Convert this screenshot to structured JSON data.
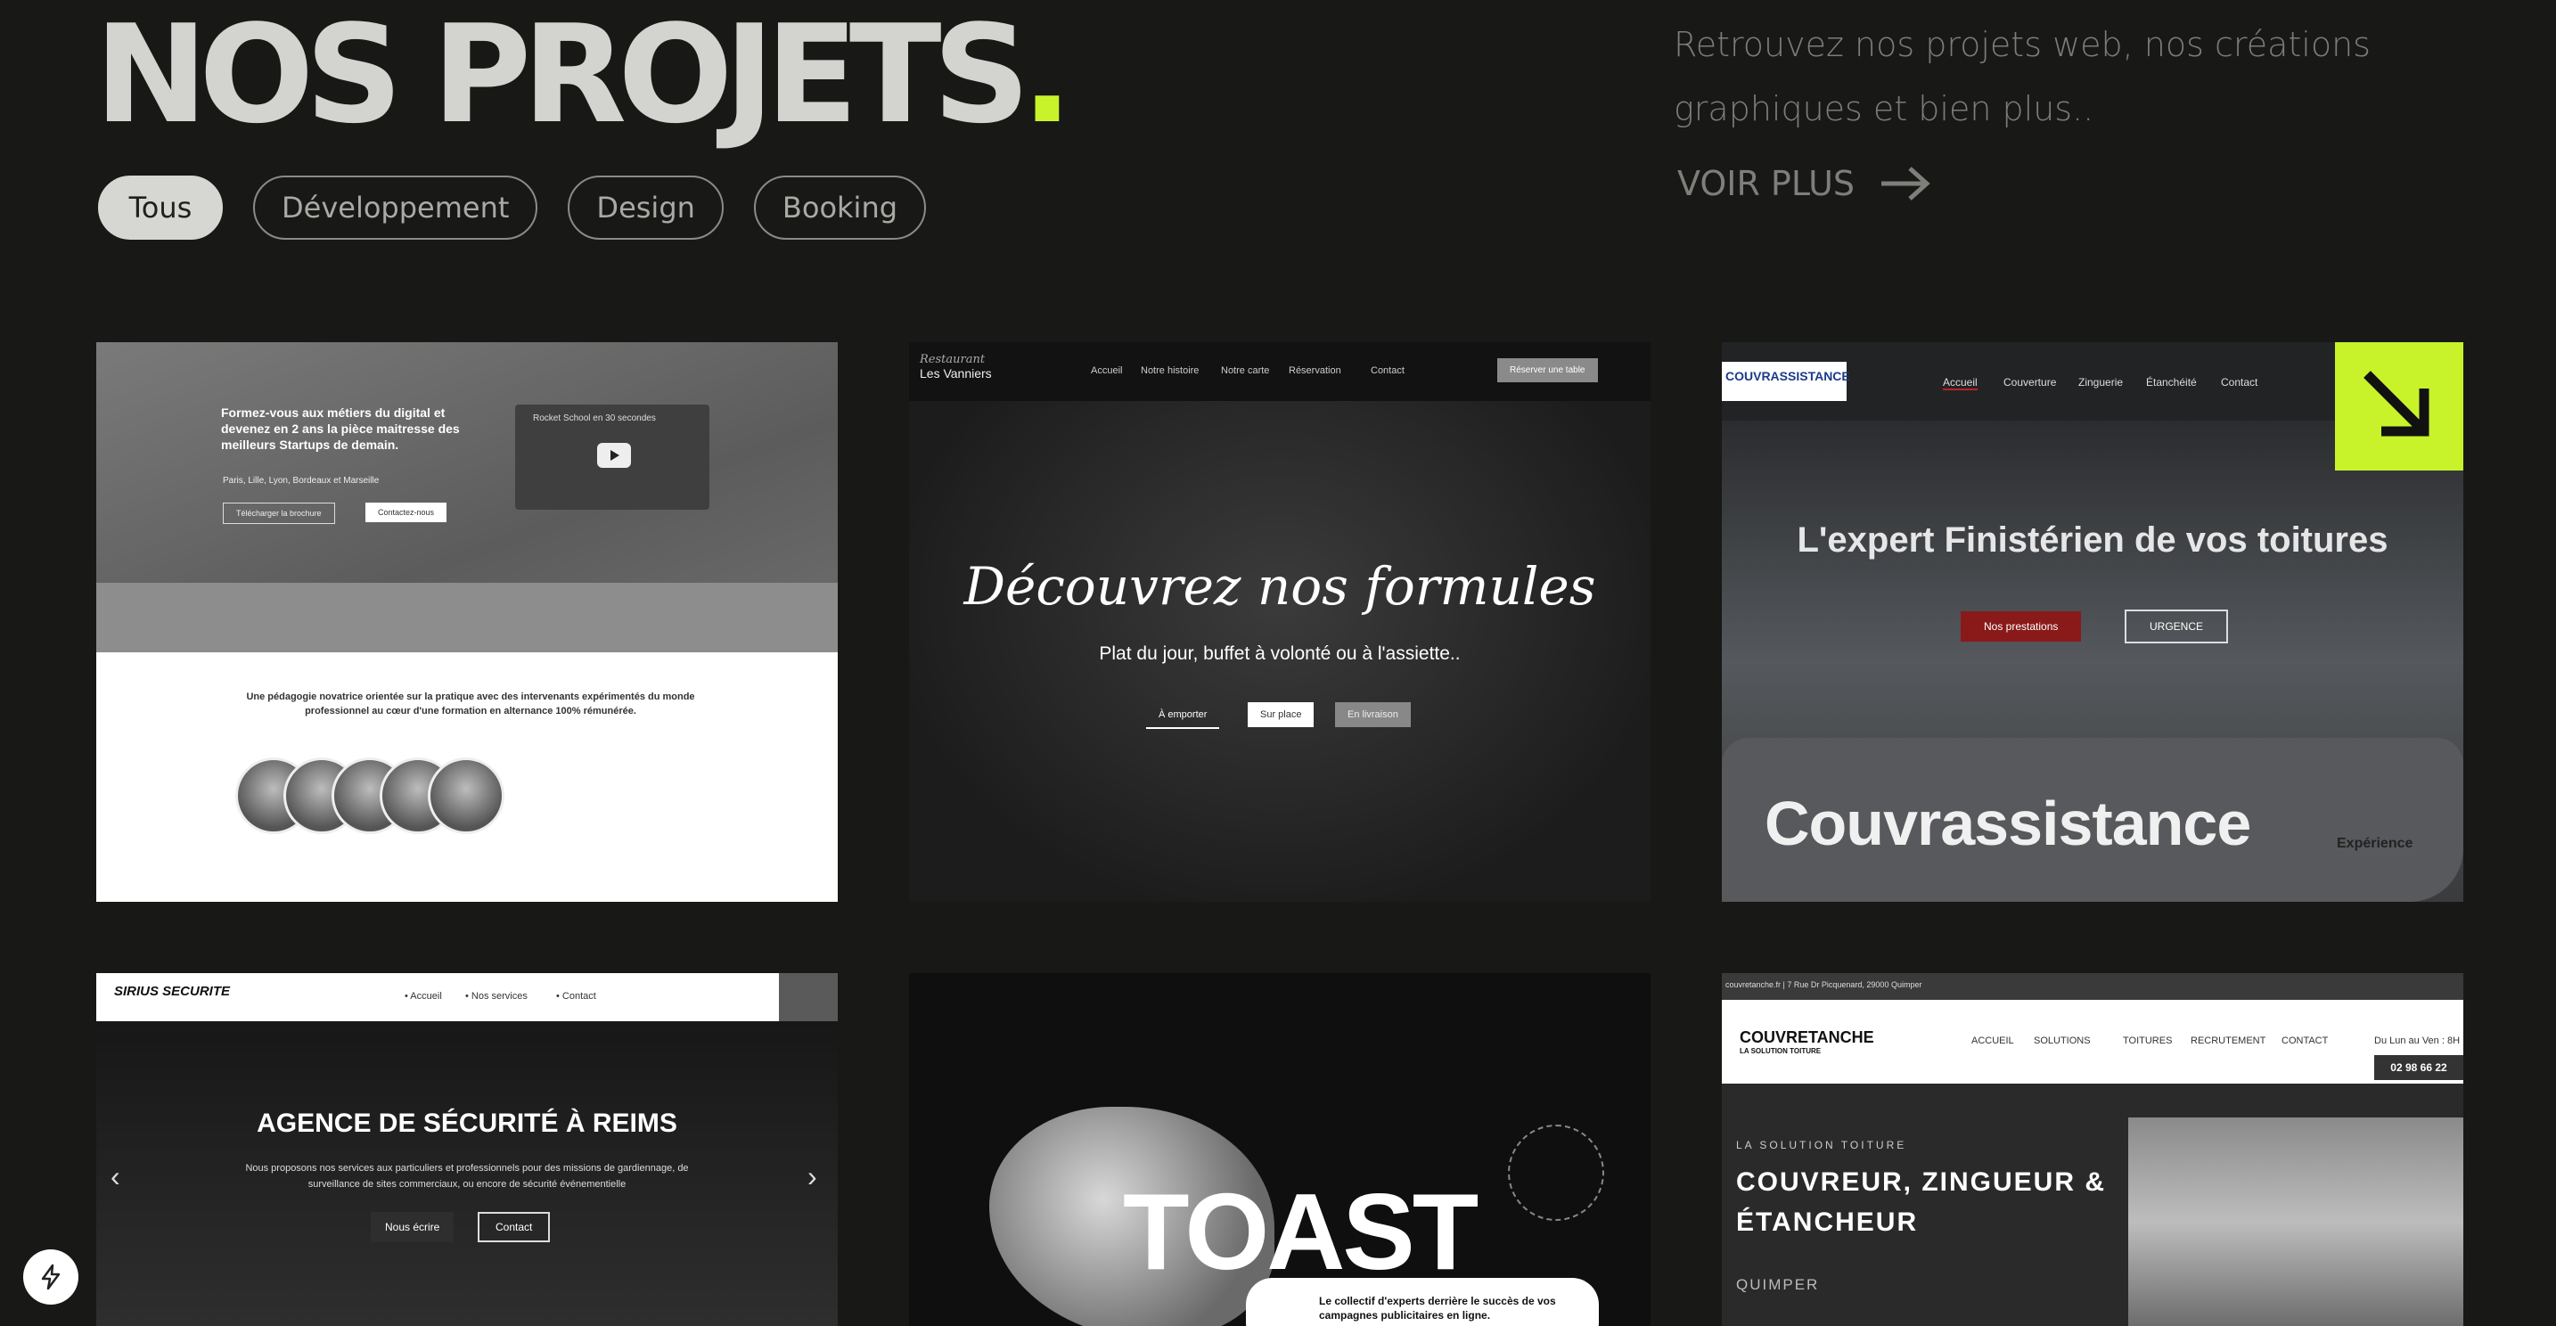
{
  "header": {
    "title": "NOS PROJETS",
    "title_dot": ".",
    "intro": "Retrouvez nos projets web, nos créations graphiques et bien plus..",
    "voir_plus": "VOIR PLUS"
  },
  "filters": [
    "Tous",
    "Développement",
    "Design",
    "Booking"
  ],
  "colors": {
    "accent": "#c8f32a",
    "background": "#181817"
  },
  "projects": [
    {
      "headline": "Formez-vous aux métiers du digital et devenez en 2 ans la pièce maitresse des meilleurs Startups de demain.",
      "locations": "Paris, Lille, Lyon, Bordeaux et Marseille",
      "btn1": "Télécharger la brochure",
      "btn2": "Contactez-nous",
      "video_title": "Rocket School en 30 secondes",
      "pedagogy": "Une pédagogie novatrice orientée sur la pratique avec des intervenants expérimentés du monde professionnel au cœur d'une formation en alternance 100% rémunérée."
    },
    {
      "logo_script": "Restaurant",
      "logo": "Les Vanniers",
      "nav": [
        "Accueil",
        "Notre histoire",
        "Notre carte",
        "Réservation",
        "Contact"
      ],
      "reserve": "Réserver une table",
      "headline": "Découvrez nos formules",
      "sub": "Plat du jour, buffet à volonté ou à l'assiette..",
      "btn1": "À emporter",
      "btn2": "Sur place",
      "btn3": "En livraison"
    },
    {
      "logo": "COUVRASSISTANCE",
      "nav": [
        "Accueil",
        "Couverture",
        "Zinguerie",
        "Étanchéité",
        "Contact"
      ],
      "headline": "L'expert Finistérien de vos toitures",
      "btn1": "Nos prestations",
      "btn2": "URGENCE",
      "name": "Couvrassistance",
      "badge": "Expérience"
    },
    {
      "logo": "SIRIUS SECURITE",
      "nav": [
        "• Accueil",
        "• Nos services",
        "• Contact"
      ],
      "headline": "AGENCE DE SÉCURITÉ À REIMS",
      "text": "Nous proposons nos services aux particuliers et professionnels pour des missions de gardiennage, de surveillance de sites commerciaux, ou encore de sécurité événementielle",
      "btn1": "Nous écrire",
      "btn2": "Contact"
    },
    {
      "name": "TOAST",
      "tagline": "Le collectif d'experts derrière le succès de vos campagnes publicitaires en ligne."
    },
    {
      "topbar": "couvretanche.fr | 7 Rue Dr Picquenard, 29000 Quimper",
      "logo": "COUVRETANCHE",
      "logo_sub": "LA SOLUTION TOITURE",
      "nav": [
        "ACCUEIL",
        "SOLUTIONS",
        "TOITURES",
        "RECRUTEMENT",
        "CONTACT"
      ],
      "hours": "Du Lun au Ven : 8H",
      "phone": "02 98 66 22",
      "tag": "LA SOLUTION TOITURE",
      "headline": "COUVREUR, ZINGUEUR & ÉTANCHEUR",
      "city": "QUIMPER"
    }
  ]
}
